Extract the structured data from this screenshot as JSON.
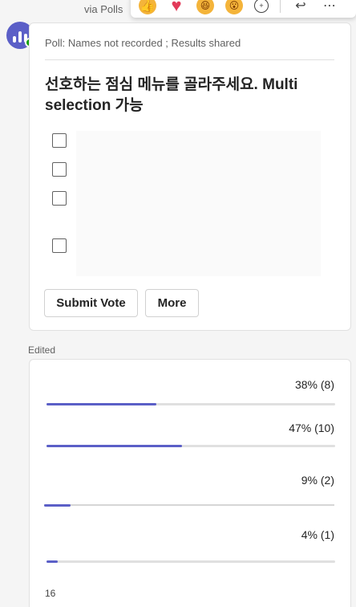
{
  "header": {
    "via": "via Polls",
    "reactions": [
      {
        "name": "like-reaction-icon",
        "glyph": "👍"
      },
      {
        "name": "heart-reaction-icon",
        "glyph": "♥"
      },
      {
        "name": "laugh-reaction-icon",
        "glyph": "😆"
      },
      {
        "name": "surprised-reaction-icon",
        "glyph": "😮"
      },
      {
        "name": "add-reaction-icon",
        "glyph": "+"
      },
      {
        "name": "reply-icon",
        "glyph": "↩"
      },
      {
        "name": "more-options-icon",
        "glyph": "⋯"
      }
    ]
  },
  "poll": {
    "meta": "Poll: Names not recorded ; Results shared",
    "question": "선호하는 점심 메뉴를 골라주세요. Multi selection 가능",
    "options_count": 4,
    "submit_label": "Submit Vote",
    "more_label": "More"
  },
  "edited_label": "Edited",
  "results": {
    "items": [
      {
        "pct_label": "38% (8)",
        "pct": 38
      },
      {
        "pct_label": "47% (10)",
        "pct": 47
      },
      {
        "pct_label": "9% (2)",
        "pct": 9
      },
      {
        "pct_label": "4% (1)",
        "pct": 4
      }
    ],
    "tail": "16"
  },
  "colors": {
    "accent": "#5b5fc7",
    "presence": "#13a10e"
  }
}
